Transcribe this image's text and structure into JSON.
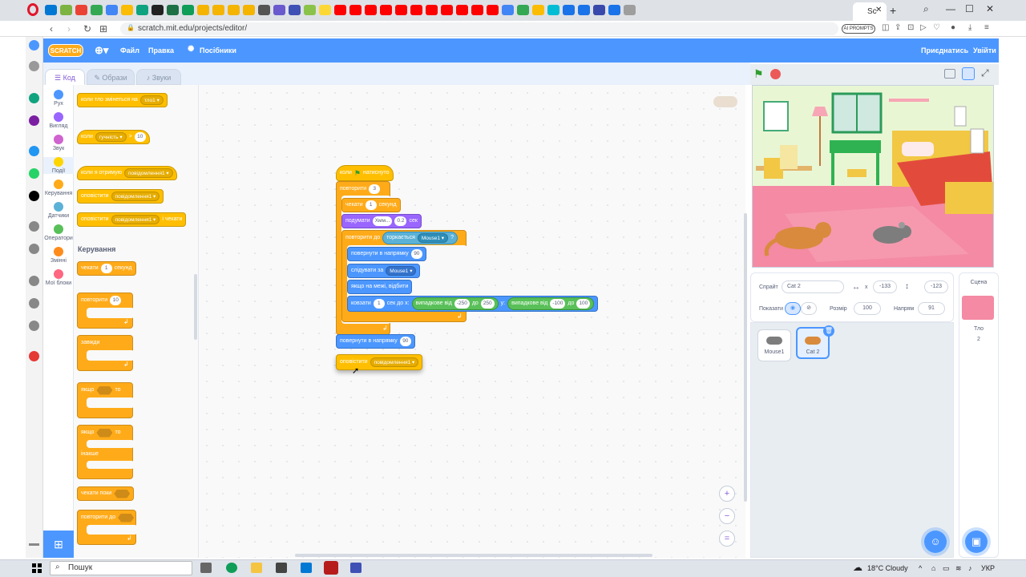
{
  "browser": {
    "active_tab_label": "Sc",
    "url": "scratch.mit.edu/projects/editor/",
    "ai_prompts_label": "AI PROMPTS"
  },
  "menu": {
    "logo": "SCRATCH",
    "file": "Файл",
    "edit": "Правка",
    "tutorials": "Посібники",
    "join": "Приєднатись",
    "signin": "Увійти"
  },
  "tabs": {
    "code": "Код",
    "costumes": "Образи",
    "sounds": "Звуки"
  },
  "categories": [
    {
      "label": "Рух",
      "color": "#4c97ff"
    },
    {
      "label": "Вигляд",
      "color": "#9966ff"
    },
    {
      "label": "Звук",
      "color": "#cf63cf"
    },
    {
      "label": "Події",
      "color": "#ffd500"
    },
    {
      "label": "Керування",
      "color": "#ffab19"
    },
    {
      "label": "Датчики",
      "color": "#5cb1d6"
    },
    {
      "label": "Оператори",
      "color": "#59c059"
    },
    {
      "label": "Змінні",
      "color": "#ff8c1a"
    },
    {
      "label": "Мої блоки",
      "color": "#ff6680"
    }
  ],
  "palette": {
    "ev1_text": "коли тло змінеться на",
    "ev1_dd": "тло1",
    "ev2_text": "коли",
    "ev2_dd": "гучність",
    "ev2_op": ">",
    "ev2_val": "10",
    "ev3_text": "коли я отримую",
    "ev3_dd": "повідомлення1",
    "ev4_text": "оповістити",
    "ev4_dd": "повідомлення1",
    "ev5_text": "оповістити",
    "ev5_dd": "повідомлення1",
    "ev5_suffix": "і чекати",
    "control_header": "Керування",
    "wait_text": "чекати",
    "wait_val": "1",
    "wait_unit": "секунд",
    "repeat_text": "повторити",
    "repeat_val": "10",
    "forever_text": "завжди",
    "if_text": "якщо",
    "if_then": "то",
    "ifelse_text": "якщо",
    "ifelse_then": "то",
    "else_text": "інакше",
    "waituntil_text": "чекати поки",
    "repeatuntil_text": "повторити до"
  },
  "script": {
    "hat": "коли",
    "hat_suffix": "натиснуто",
    "repeat": "повторити",
    "repeat_val": "3",
    "wait": "чекати",
    "wait_val": "1",
    "wait_unit": "секунд",
    "think": "подумати",
    "think_val": "Хмм...",
    "think_time": "0.2",
    "think_unit": "сек",
    "repeat_until": "повторити до",
    "touching": "торкається",
    "touching_dd": "Mouse1",
    "touching_q": "?",
    "point_dir": "повернути в напрямку",
    "point_dir_val": "90",
    "follow": "слідувати за",
    "follow_dd": "Mouse1",
    "bounce": "якщо на межі, відбити",
    "glide": "ковзати",
    "glide_val": "1",
    "glide_mid": "сек до x:",
    "rand1": "випадкове від",
    "rand1_a": "-250",
    "rand1_to": "до",
    "rand1_b": "250",
    "glide_y": "y:",
    "rand2": "випадкове від",
    "rand2_a": "-100",
    "rand2_to": "до",
    "rand2_b": "100",
    "point_dir2": "повернути в напрямку",
    "point_dir2_val": "90",
    "broadcast": "оповістити",
    "broadcast_dd": "повідомлення1"
  },
  "sprite_info": {
    "sprite_label": "Спрайт",
    "sprite_name": "Cat 2",
    "x_label": "x",
    "x_val": "-133",
    "y_label": "y",
    "y_val": "-123",
    "show_label": "Показати",
    "size_label": "Розмір",
    "size_val": "100",
    "dir_label": "Напрям",
    "dir_val": "91"
  },
  "sprites": [
    {
      "name": "Mouse1"
    },
    {
      "name": "Cat 2"
    }
  ],
  "stage_panel": {
    "title": "Сцена",
    "backdrops_label": "Тло",
    "backdrops_count": "2"
  },
  "taskbar": {
    "search": "Пошук",
    "weather": "18°C Cloudy",
    "lang": "УКР"
  }
}
